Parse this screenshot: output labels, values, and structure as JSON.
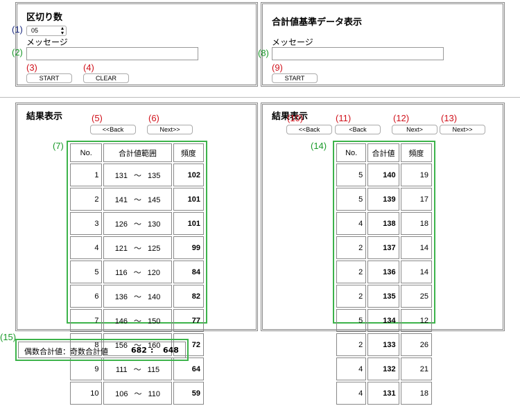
{
  "top_left": {
    "title": "区切り数",
    "select_value": "05",
    "message_label": "メッセージ",
    "message_value": "",
    "start_label": "START",
    "clear_label": "CLEAR"
  },
  "top_right": {
    "title": "合計値基準データ表示",
    "message_label": "メッセージ",
    "message_value": "",
    "start_label": "START"
  },
  "annotations": {
    "a1": "(1)",
    "a2": "(2)",
    "a3": "(3)",
    "a4": "(4)",
    "a5": "(5)",
    "a6": "(6)",
    "a7": "(7)",
    "a8": "(8)",
    "a9": "(9)",
    "a10": "(10)",
    "a11": "(11)",
    "a12": "(12)",
    "a13": "(13)",
    "a14": "(14)",
    "a15": "(15)"
  },
  "bottom_left": {
    "title": "結果表示",
    "back_label": "<<Back",
    "next_label": "Next>>",
    "headers": [
      "No.",
      "合計値範囲",
      "頻度"
    ],
    "range_sep": "〜",
    "rows": [
      {
        "no": "1",
        "from": "131",
        "to": "135",
        "freq": "102"
      },
      {
        "no": "2",
        "from": "141",
        "to": "145",
        "freq": "101"
      },
      {
        "no": "3",
        "from": "126",
        "to": "130",
        "freq": "101"
      },
      {
        "no": "4",
        "from": "121",
        "to": "125",
        "freq": "99"
      },
      {
        "no": "5",
        "from": "116",
        "to": "120",
        "freq": "84"
      },
      {
        "no": "6",
        "from": "136",
        "to": "140",
        "freq": "82"
      },
      {
        "no": "7",
        "from": "146",
        "to": "150",
        "freq": "77"
      },
      {
        "no": "8",
        "from": "156",
        "to": "160",
        "freq": "72"
      },
      {
        "no": "9",
        "from": "111",
        "to": "115",
        "freq": "64"
      },
      {
        "no": "10",
        "from": "106",
        "to": "110",
        "freq": "59"
      }
    ]
  },
  "bottom_right": {
    "title": "結果表示",
    "back_far_label": "<<Back",
    "back_label": "<Back",
    "next_label": "Next>",
    "next_far_label": "Next>>",
    "headers": [
      "No.",
      "合計値",
      "頻度"
    ],
    "rows": [
      {
        "no": "5",
        "sum": "140",
        "freq": "19"
      },
      {
        "no": "5",
        "sum": "139",
        "freq": "17"
      },
      {
        "no": "4",
        "sum": "138",
        "freq": "18"
      },
      {
        "no": "2",
        "sum": "137",
        "freq": "14"
      },
      {
        "no": "2",
        "sum": "136",
        "freq": "14"
      },
      {
        "no": "2",
        "sum": "135",
        "freq": "25"
      },
      {
        "no": "5",
        "sum": "134",
        "freq": "12"
      },
      {
        "no": "2",
        "sum": "133",
        "freq": "26"
      },
      {
        "no": "4",
        "sum": "132",
        "freq": "21"
      },
      {
        "no": "4",
        "sum": "131",
        "freq": "18"
      }
    ]
  },
  "summary": {
    "label": "偶数合計値：奇数合計値",
    "even": "682",
    "sep": ":",
    "odd": "648"
  }
}
